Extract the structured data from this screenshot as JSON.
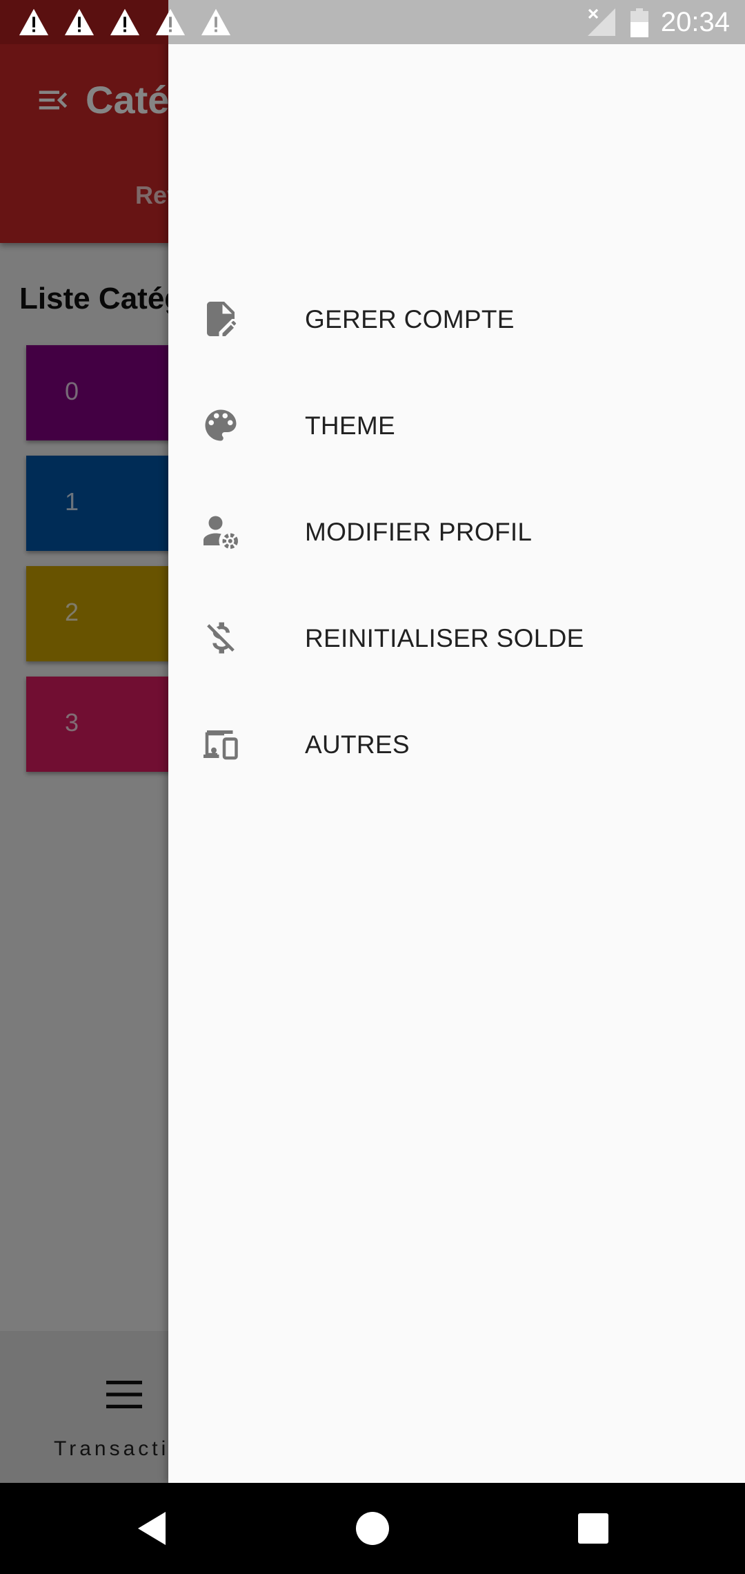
{
  "status_bar": {
    "time": "20:34",
    "notification_icons": [
      "warning-icon",
      "warning-icon",
      "warning-icon",
      "warning-icon",
      "warning-icon"
    ]
  },
  "app_bar": {
    "title": "Catégories",
    "tab_label": "Revenus",
    "color": "#c62828"
  },
  "list": {
    "title": "Liste Catégories",
    "items": [
      {
        "label": "0",
        "color": "#800080"
      },
      {
        "label": "1",
        "color": "#0055a5"
      },
      {
        "label": "2",
        "color": "#c8a000"
      },
      {
        "label": "3",
        "color": "#d81b60"
      }
    ]
  },
  "bottom_nav": {
    "label": "Transactions",
    "icon": "menu-icon"
  },
  "drawer": {
    "items": [
      {
        "label": "GERER COMPTE",
        "icon": "edit-document-icon"
      },
      {
        "label": "THEME",
        "icon": "palette-icon"
      },
      {
        "label": "MODIFIER PROFIL",
        "icon": "manage-account-icon"
      },
      {
        "label": "REINITIALISER SOLDE",
        "icon": "money-off-icon"
      },
      {
        "label": "AUTRES",
        "icon": "devices-icon"
      }
    ]
  },
  "nav_bar": {
    "icons": [
      "back-icon",
      "home-icon",
      "recents-icon"
    ]
  }
}
